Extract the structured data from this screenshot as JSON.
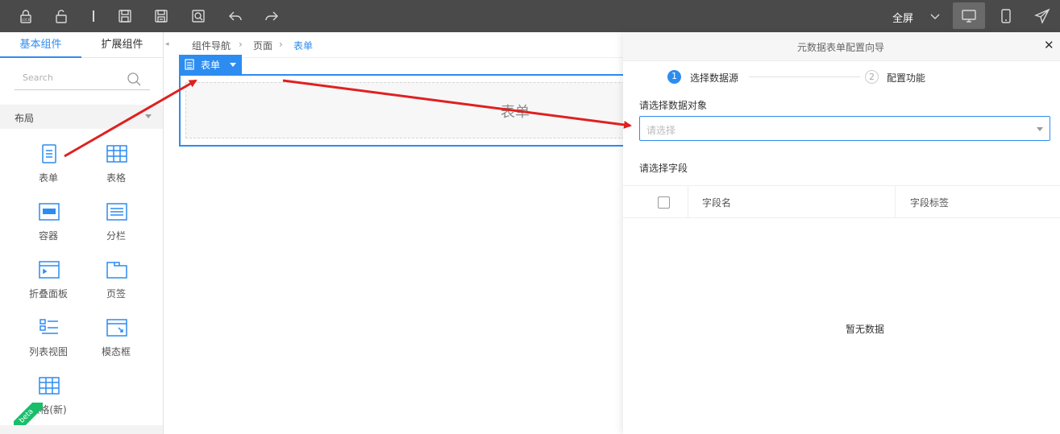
{
  "toolbar": {
    "icons": [
      "lock-icon",
      "unlock-icon",
      "cursor-icon",
      "save-icon",
      "save-as-icon",
      "preview-icon",
      "undo-icon",
      "redo-icon"
    ],
    "fullscreen_label": "全屏",
    "devices": [
      "desktop-icon",
      "mobile-icon",
      "publish-icon"
    ]
  },
  "left_panel": {
    "tabs": [
      {
        "label": "基本组件",
        "active": true
      },
      {
        "label": "扩展组件",
        "active": false
      }
    ],
    "search_placeholder": "Search",
    "section_title": "布局",
    "components": [
      {
        "label": "表单",
        "icon": "form-icon"
      },
      {
        "label": "表格",
        "icon": "table-icon"
      },
      {
        "label": "容器",
        "icon": "container-icon"
      },
      {
        "label": "分栏",
        "icon": "columns-icon"
      },
      {
        "label": "折叠面板",
        "icon": "collapse-panel-icon"
      },
      {
        "label": "页签",
        "icon": "tabs-icon"
      },
      {
        "label": "列表视图",
        "icon": "list-view-icon"
      },
      {
        "label": "模态框",
        "icon": "modal-icon"
      },
      {
        "label": "表格(新)",
        "icon": "table-new-icon"
      }
    ],
    "beta_badge": "beta"
  },
  "breadcrumb": {
    "items": [
      "组件导航",
      "页面",
      "表单"
    ]
  },
  "canvas": {
    "form_tag": "表单",
    "form_placeholder": "表单"
  },
  "wizard": {
    "title": "元数据表单配置向导",
    "steps": [
      {
        "num": "1",
        "label": "选择数据源",
        "active": true
      },
      {
        "num": "2",
        "label": "配置功能",
        "active": false
      }
    ],
    "object_label": "请选择数据对象",
    "object_placeholder": "请选择",
    "field_label": "请选择字段",
    "columns": [
      "字段名",
      "字段标签"
    ],
    "empty_text": "暂无数据"
  },
  "colors": {
    "accent": "#2d8cf0",
    "toolbar_bg": "#4a4a4a",
    "arrow": "#e02020",
    "beta": "#19be6b"
  }
}
